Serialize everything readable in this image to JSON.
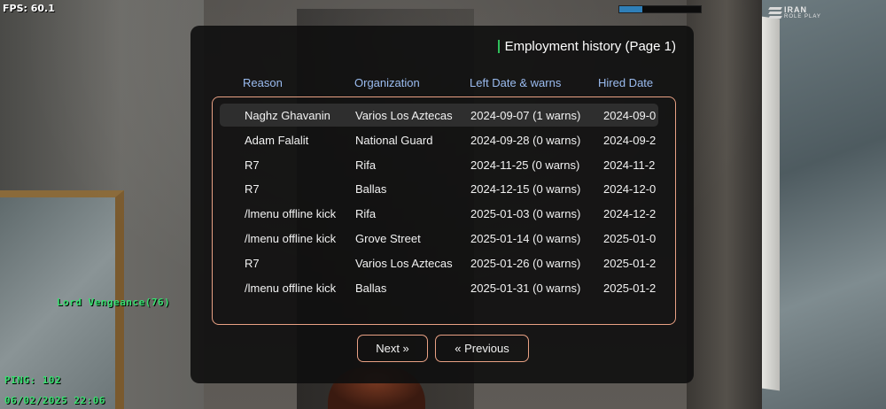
{
  "hud": {
    "fps": "FPS: 60.1",
    "server_bar_fill": 0.28,
    "logo_line1": "IRAN",
    "logo_line2": "ROLE PLAY",
    "player_tag": "Lord Vengeance(76)",
    "ping": "PING: 102",
    "datetime": "06/02/2025 22:06"
  },
  "dialog": {
    "title": "Employment history (Page 1)",
    "columns": [
      "Reason",
      "Organization",
      "Left Date & warns",
      "Hired Date"
    ],
    "rows": [
      [
        "Naghz Ghavanin",
        "Varios Los Aztecas",
        "2024-09-07 (1 warns)",
        "2024-09-0"
      ],
      [
        "Adam Falalit",
        "National Guard",
        "2024-09-28 (0 warns)",
        "2024-09-2"
      ],
      [
        "R7",
        "Rifa",
        "2024-11-25 (0 warns)",
        "2024-11-2"
      ],
      [
        "R7",
        "Ballas",
        "2024-12-15 (0 warns)",
        "2024-12-0"
      ],
      [
        "/lmenu offline kick",
        "Rifa",
        "2025-01-03 (0 warns)",
        "2024-12-2"
      ],
      [
        "/lmenu offline kick",
        "Grove Street",
        "2025-01-14 (0 warns)",
        "2025-01-0"
      ],
      [
        "R7",
        "Varios Los Aztecas",
        "2025-01-26 (0 warns)",
        "2025-01-2"
      ],
      [
        "/lmenu offline kick",
        "Ballas",
        "2025-01-31 (0 warns)",
        "2025-01-2"
      ]
    ],
    "selected_row": 0,
    "buttons": {
      "next": "Next »",
      "previous": "« Previous"
    }
  },
  "colors": {
    "accent_border": "#e9a184",
    "header_text": "#9bbcf0",
    "title_accent": "#2fbf5b",
    "hud_green": "#38e070"
  }
}
